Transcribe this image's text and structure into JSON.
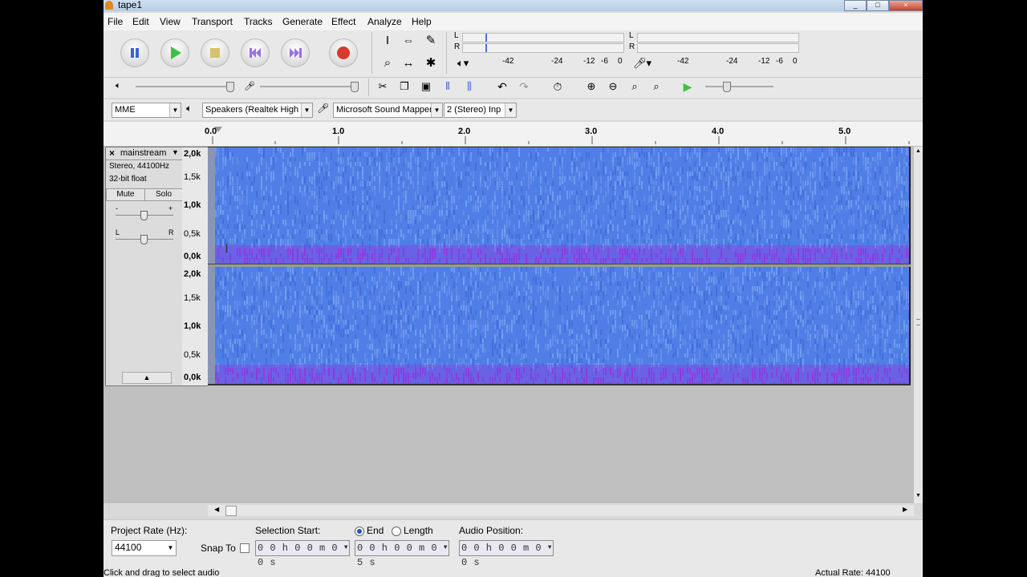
{
  "window": {
    "title": "tape1",
    "controls": [
      "_",
      "□",
      "×"
    ]
  },
  "menu": [
    "File",
    "Edit",
    "View",
    "Transport",
    "Tracks",
    "Generate",
    "Effect",
    "Analyze",
    "Help"
  ],
  "transport": {
    "pause": "pause",
    "play": "play",
    "stop": "stop",
    "skip_start": "skip-to-start",
    "skip_end": "skip-to-end",
    "record": "record"
  },
  "tools": {
    "select": "I",
    "envelope": "⇔",
    "draw": "✎",
    "zoom": "⌕",
    "timeshift": "↔",
    "multi": "✱"
  },
  "meters": {
    "play_channels": [
      "L",
      "R"
    ],
    "play_scale": [
      "-42",
      "-24",
      "-12",
      "-6",
      "0"
    ],
    "rec_channels": [
      "L",
      "R"
    ],
    "rec_scale": [
      "-42",
      "-24",
      "-12",
      "-6",
      "0"
    ]
  },
  "devices": {
    "host": "MME",
    "output": "Speakers (Realtek High",
    "input": "Microsoft Sound Mapper",
    "channels": "2 (Stereo) Inp"
  },
  "ruler": {
    "start": "0.0",
    "labels": [
      "1.0",
      "2.0",
      "3.0",
      "4.0",
      "5.0"
    ]
  },
  "track": {
    "name": "mainstream",
    "info_line1": "Stereo, 44100Hz",
    "info_line2": "32-bit float",
    "mute": "Mute",
    "solo": "Solo",
    "gain_minus": "-",
    "gain_plus": "+",
    "pan_left": "L",
    "pan_right": "R",
    "freq_labels": [
      "2,0k",
      "1,5k",
      "1,0k",
      "0,5k",
      "0,0k"
    ]
  },
  "selection": {
    "project_rate_label": "Project Rate (Hz):",
    "project_rate": "44100",
    "snap_to": "Snap To",
    "sel_start_label": "Selection Start:",
    "end_label": "End",
    "length_label": "Length",
    "audio_pos_label": "Audio Position:",
    "sel_start": "0 0 h 0 0 m 0 0 s",
    "sel_end": "0 0 h 0 0 m 0 5 s",
    "audio_pos": "0 0 h 0 0 m 0 0 s"
  },
  "status": {
    "left": "Click and drag to select audio",
    "right": "Actual Rate: 44100"
  },
  "colors": {
    "spectrogram_base": "#4f7fe6",
    "spectrogram_low": "#9b2fe0",
    "record": "#d63b2e",
    "play": "#3cc23c"
  }
}
